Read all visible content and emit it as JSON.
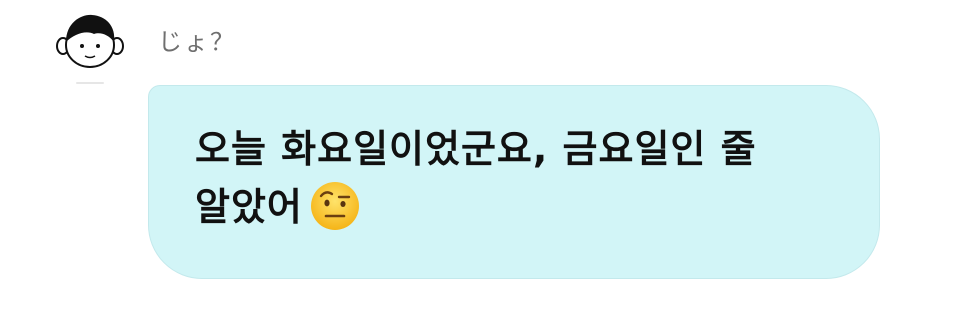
{
  "sender": {
    "name": "じょ？"
  },
  "message": {
    "text_line1": "오늘 화요일이었군요, 금요일인 줄",
    "text_line2": "알았어",
    "emoji": "face-with-raised-eyebrow-icon"
  },
  "colors": {
    "bubble_background": "#d2f5f7",
    "bubble_border": "#c3e9ec",
    "sender_name": "#6f6f6f",
    "message_text": "#111111"
  }
}
